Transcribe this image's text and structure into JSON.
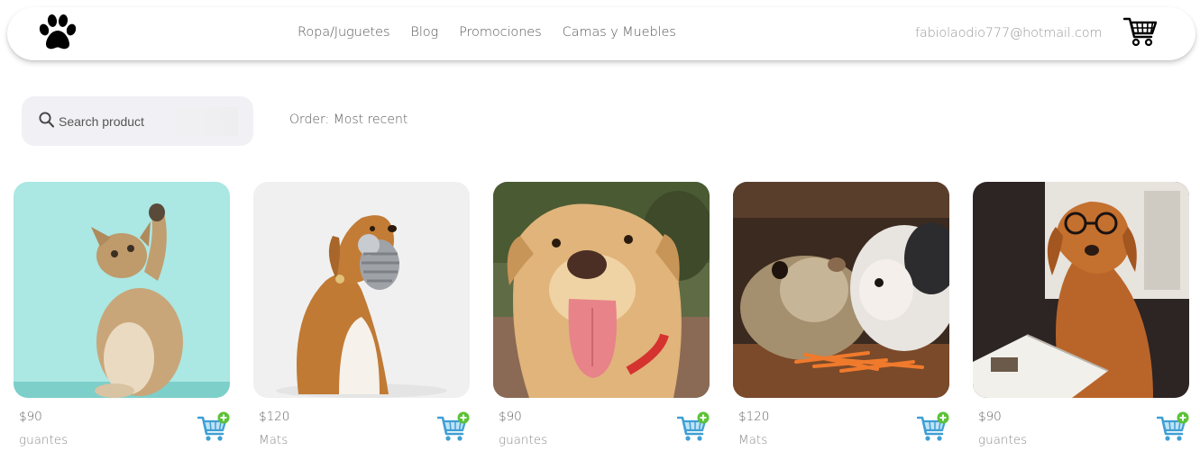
{
  "header": {
    "nav": [
      {
        "label": "Ropa/Juguetes"
      },
      {
        "label": "Blog"
      },
      {
        "label": "Promociones"
      },
      {
        "label": "Camas y Muebles"
      }
    ],
    "user_email": "fabiolaodio777@hotmail.com",
    "logo_icon": "paw-icon",
    "cart_icon": "shopping-cart-icon"
  },
  "filters": {
    "search_placeholder": "Search product",
    "order_label": "Order: Most recent"
  },
  "products": [
    {
      "price": "$90",
      "name": "guantes",
      "image": "kitten-raising-paw",
      "bg": "#a7e6e2"
    },
    {
      "price": "$120",
      "name": "Mats",
      "image": "dog-with-plush-toy",
      "bg": "#efefef"
    },
    {
      "price": "$90",
      "name": "guantes",
      "image": "labrador-tongue-out",
      "bg": "#6b7a4e"
    },
    {
      "price": "$120",
      "name": "Mats",
      "image": "guinea-pigs-carrots",
      "bg": "#4a3526"
    },
    {
      "price": "$90",
      "name": "guantes",
      "image": "dog-with-glasses-reading",
      "bg": "#2e2424"
    }
  ],
  "colors": {
    "search_bg": "#f1f0f4",
    "add_cart_blue": "#4aa6d8",
    "add_cart_green": "#5bc236"
  }
}
